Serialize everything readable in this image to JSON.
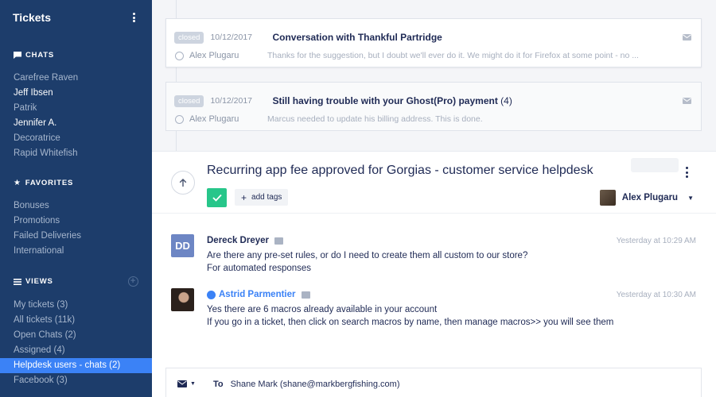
{
  "sidebar": {
    "title": "Tickets",
    "chats": {
      "heading": "CHATS",
      "items": [
        {
          "label": "Carefree Raven"
        },
        {
          "label": "Jeff Ibsen"
        },
        {
          "label": "Patrik"
        },
        {
          "label": "Jennifer A."
        },
        {
          "label": "Decoratrice"
        },
        {
          "label": "Rapid Whitefish"
        }
      ]
    },
    "favorites": {
      "heading": "FAVORITES",
      "items": [
        {
          "label": "Bonuses"
        },
        {
          "label": "Promotions"
        },
        {
          "label": "Failed Deliveries"
        },
        {
          "label": "International"
        }
      ]
    },
    "views": {
      "heading": "VIEWS",
      "add_symbol": "+",
      "items": [
        {
          "label": "My tickets (3)"
        },
        {
          "label": "All tickets (11k)"
        },
        {
          "label": "Open Chats (2)"
        },
        {
          "label": "Assigned (4)"
        },
        {
          "label": "Helpdesk users - chats (2)"
        },
        {
          "label": "Facebook (3)"
        }
      ]
    }
  },
  "related_tickets": [
    {
      "status": "closed",
      "date": "10/12/2017",
      "subject": "Conversation with Thankful Partridge",
      "count": "",
      "author": "Alex Plugaru",
      "snippet": "Thanks for the suggestion, but I doubt we'll ever do it. We might do it for Firefox at some point - no ..."
    },
    {
      "status": "closed",
      "date": "10/12/2017",
      "subject": "Still having trouble with your Ghost(Pro) payment",
      "count": "(4)",
      "author": "Alex Plugaru",
      "snippet": "Marcus needed to update his billing address. This is done."
    }
  ],
  "ticket": {
    "subject": "Recurring app fee approved for Gorgias - customer service helpdesk",
    "add_tags_label": "add tags",
    "assignee": "Alex Plugaru",
    "messages": [
      {
        "initials": "DD",
        "name": "Dereck Dreyer",
        "time": "Yesterday at 10:29 AM",
        "lines": [
          "Are there any pre-set rules, or do I need to create them all custom to our store?",
          "For automated responses"
        ]
      },
      {
        "name": "Astrid Parmentier",
        "time": "Yesterday at 10:30 AM",
        "lines": [
          "Yes there are 6 macros already available in your account",
          "If you go in a ticket, then click on search macros by name, then manage macros>> you will see them"
        ]
      }
    ],
    "reply": {
      "to_label": "To",
      "to_value": "Shane Mark (shane@markbergfishing.com)"
    }
  }
}
